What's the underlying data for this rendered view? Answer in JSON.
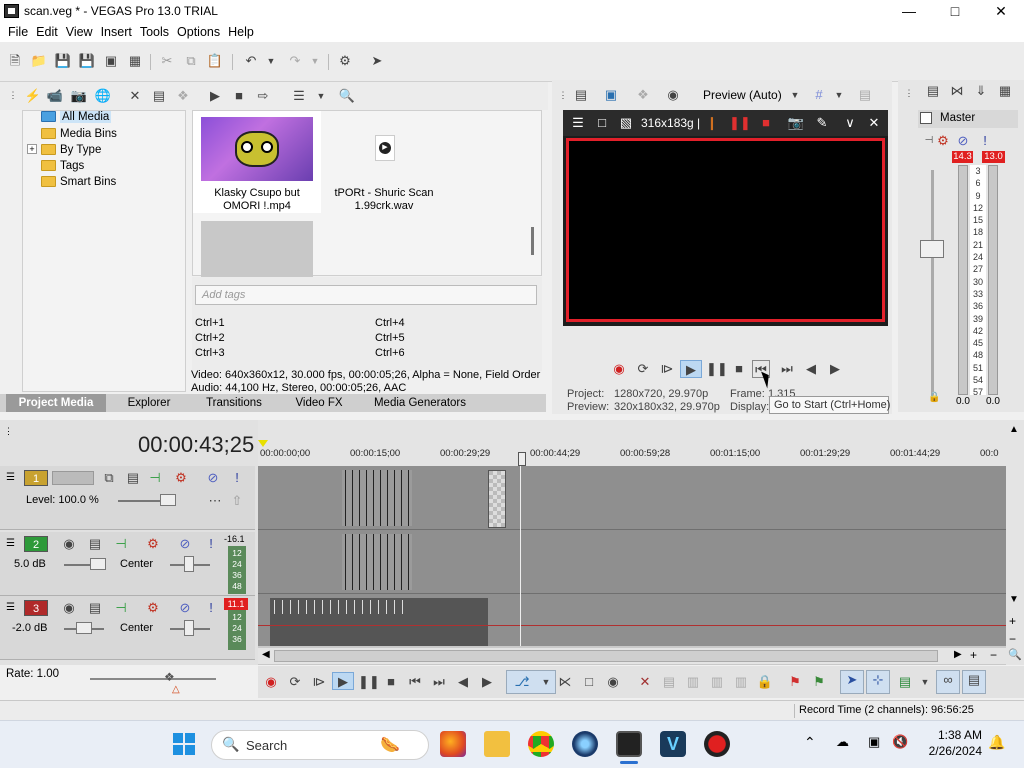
{
  "window": {
    "title": "scan.veg * - VEGAS Pro 13.0 TRIAL",
    "min_icon": "minimize-icon",
    "max_icon": "maximize-icon",
    "close_icon": "close-icon"
  },
  "menu": [
    "File",
    "Edit",
    "View",
    "Insert",
    "Tools",
    "Options",
    "Help"
  ],
  "project_media": {
    "tree": [
      "All Media",
      "Media Bins",
      "By Type",
      "Tags",
      "Smart Bins"
    ],
    "items": [
      {
        "name": "Klasky Csupo but OMORI !.mp4"
      },
      {
        "name": "tPORt - Shuric Scan 1.99crk.wav"
      }
    ],
    "tags_placeholder": "Add tags",
    "shortcuts": [
      "Ctrl+1",
      "Ctrl+2",
      "Ctrl+3",
      "Ctrl+4",
      "Ctrl+5",
      "Ctrl+6"
    ],
    "info_video": "Video: 640x360x12, 30.000 fps, 00:00:05;26, Alpha = None, Field Order",
    "info_audio": "Audio: 44,100 Hz, Stereo, 00:00:05;26, AAC",
    "tabs": [
      "Project Media",
      "Explorer",
      "Transitions",
      "Video FX",
      "Media Generators"
    ]
  },
  "preview": {
    "mode": "Preview (Auto)",
    "resolution_label": "316x183g |",
    "project": "Project:",
    "project_val": "1280x720, 29.970p",
    "preview_label": "Preview:",
    "preview_val": "320x180x32, 29.970p",
    "frame_label": "Frame:",
    "frame_val": "1,315",
    "display_label": "Display:",
    "tooltip": "Go to Start (Ctrl+Home)"
  },
  "master": {
    "label": "Master",
    "peak_left": "14.3",
    "peak_right": "13.0",
    "scale": [
      "3",
      "6",
      "9",
      "12",
      "15",
      "18",
      "21",
      "24",
      "27",
      "30",
      "33",
      "36",
      "39",
      "42",
      "45",
      "48",
      "51",
      "54",
      "57"
    ],
    "bottom_left": "0.0",
    "bottom_right": "0.0"
  },
  "timeline": {
    "timecode": "00:00:43;25",
    "ruler": [
      "00:00:00;00",
      "00:00:15;00",
      "00:00:29;29",
      "00:00:44;29",
      "00:00:59;28",
      "00:01:15;00",
      "00:01:29;29",
      "00:01:44;29",
      "00:0"
    ],
    "tracks": [
      {
        "num": "1",
        "level": "Level: 100.0 %",
        "pan": ""
      },
      {
        "num": "2",
        "level": "5.0 dB",
        "pan": "Center",
        "peak": "-16.1",
        "scale": [
          "12",
          "24",
          "36",
          "48"
        ]
      },
      {
        "num": "3",
        "level": "-2.0 dB",
        "pan": "Center",
        "peak": "11.1",
        "scale": [
          "12",
          "24",
          "36"
        ]
      }
    ],
    "rate": "Rate: 1.00",
    "track_colors": {
      "t1": "#c8a230",
      "t2": "#2e9a3a",
      "t3": "#b02a2a"
    }
  },
  "status": {
    "record_time": "Record Time (2 channels): 96:56:25"
  },
  "taskbar": {
    "search": "Search",
    "time": "1:38 AM",
    "date": "2/26/2024"
  }
}
